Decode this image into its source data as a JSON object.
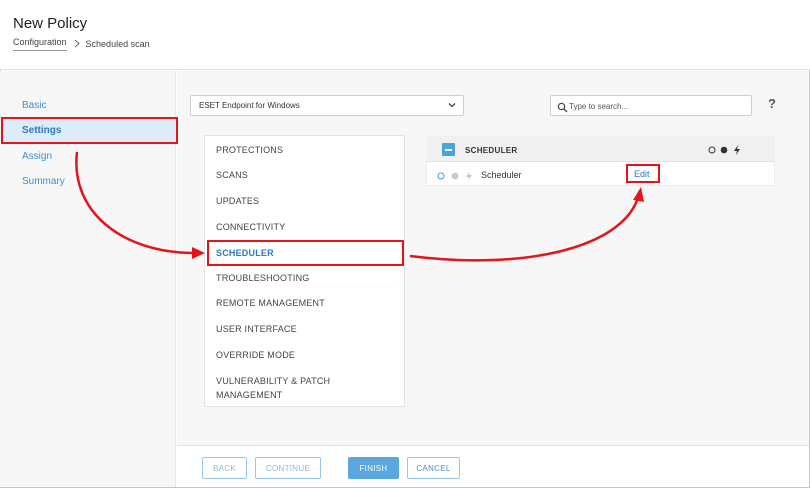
{
  "header": {
    "title": "New Policy",
    "breadcrumb": [
      "Configuration",
      "Scheduled scan"
    ]
  },
  "sidebar": {
    "items": [
      {
        "label": "Basic",
        "active": false
      },
      {
        "label": "Settings",
        "active": true
      },
      {
        "label": "Assign",
        "active": false
      },
      {
        "label": "Summary",
        "active": false
      }
    ]
  },
  "product_select": {
    "value": "ESET Endpoint for Windows"
  },
  "search": {
    "placeholder": "Type to search..."
  },
  "help": {
    "label": "?"
  },
  "categories": {
    "items": [
      {
        "label": "PROTECTIONS"
      },
      {
        "label": "SCANS"
      },
      {
        "label": "UPDATES"
      },
      {
        "label": "CONNECTIVITY"
      },
      {
        "label": "SCHEDULER",
        "active": true
      },
      {
        "label": "TROUBLESHOOTING"
      },
      {
        "label": "REMOTE MANAGEMENT"
      },
      {
        "label": "USER INTERFACE"
      },
      {
        "label": "OVERRIDE MODE"
      },
      {
        "label": "VULNERABILITY & PATCH MANAGEMENT"
      }
    ]
  },
  "scheduler_panel": {
    "title": "SCHEDULER",
    "row_label": "Scheduler",
    "edit_label": "Edit"
  },
  "footer": {
    "back": "BACK",
    "continue": "CONTINUE",
    "finish": "FINISH",
    "cancel": "CANCEL"
  },
  "colors": {
    "accent": "#2a7bbf",
    "annotation": "#e3141b",
    "primary_button": "#5aa6e0"
  }
}
